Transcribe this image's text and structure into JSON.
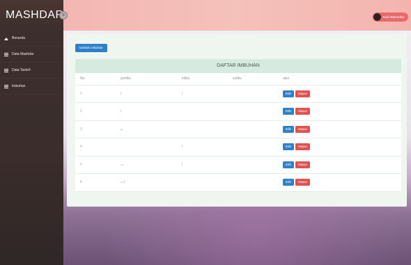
{
  "brand": {
    "title": "MASHDAR",
    "toggle_icon": "menu-toggle-icon"
  },
  "sidebar": {
    "items": [
      {
        "label": "Beranda",
        "icon": "home-icon"
      },
      {
        "label": "Data Mashdar",
        "icon": "list-icon"
      },
      {
        "label": "Data Tashrif",
        "icon": "list-icon"
      },
      {
        "label": "Imbuhan",
        "icon": "list-icon"
      }
    ]
  },
  "topbar": {
    "user_name": "Budi Mahendra"
  },
  "main": {
    "add_button": "tambah imbuhan",
    "table": {
      "title": "DAFTAR IMBUHAN",
      "headers": [
        "No",
        "prefiks",
        "infiks",
        "sufiks",
        "aksi"
      ],
      "rows": [
        {
          "no": "1",
          "prefiks": "ا",
          "infiks": "ا",
          "sufiks": ""
        },
        {
          "no": "2",
          "prefiks": "ا",
          "infiks": "",
          "sufiks": ""
        },
        {
          "no": "3",
          "prefiks": "م",
          "infiks": "",
          "sufiks": ""
        },
        {
          "no": "4",
          "prefiks": "",
          "infiks": "ا",
          "sufiks": ""
        },
        {
          "no": "5",
          "prefiks": "ت",
          "infiks": "ا",
          "sufiks": ""
        },
        {
          "no": "6",
          "prefiks": "ات",
          "infiks": "",
          "sufiks": ""
        }
      ],
      "edit_label": "Edit",
      "delete_label": "Hapus"
    }
  },
  "colors": {
    "sidebar_bg": "#3c2f2c",
    "topbar_bg": "#f3b7b2",
    "primary": "#2f80c8",
    "danger": "#e0524f",
    "table_title_bg": "#d6eadf"
  }
}
